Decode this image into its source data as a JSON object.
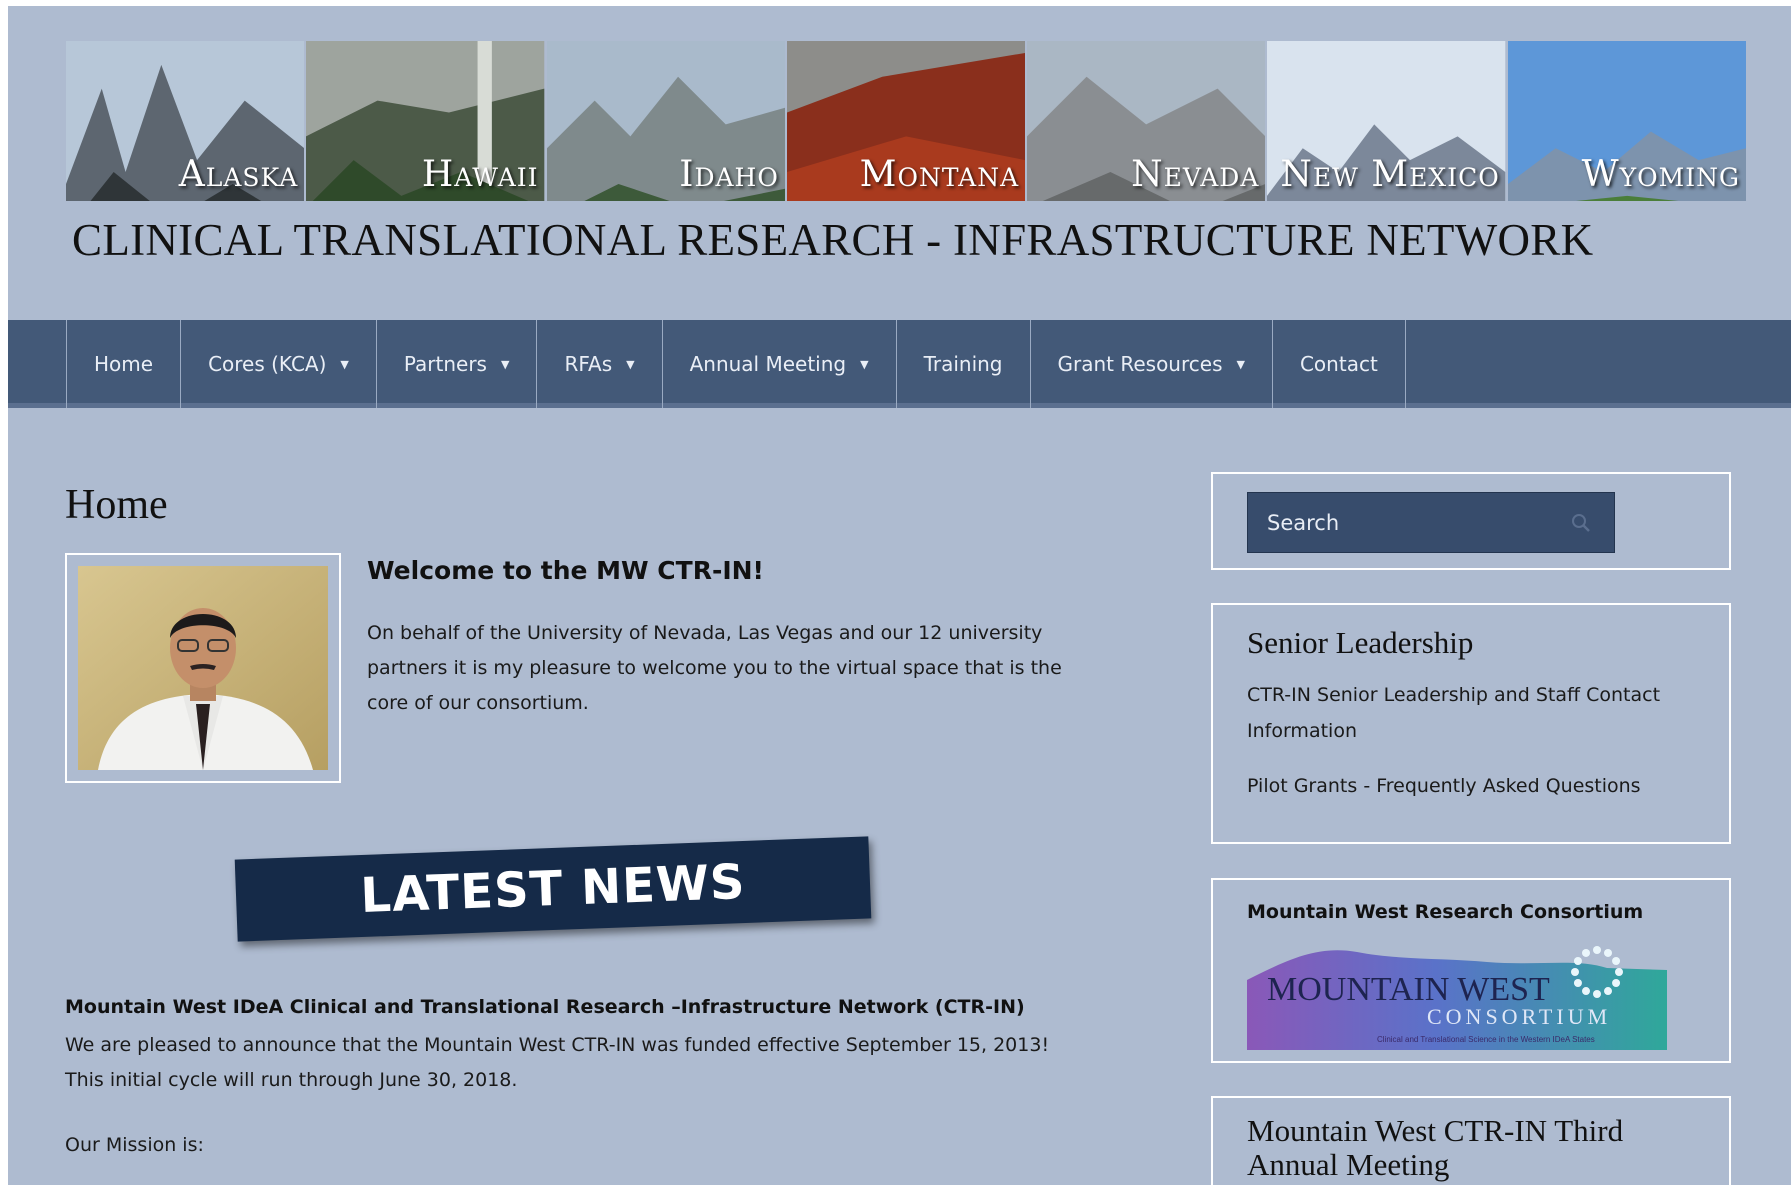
{
  "banner": {
    "states": [
      {
        "name": "Alaska",
        "sky": "#b7c7d8",
        "far": "#5d6670",
        "near": "#2f3538"
      },
      {
        "name": "Hawaii",
        "sky": "#9ea49e",
        "far": "#4c5a48",
        "near": "#2f4a2a"
      },
      {
        "name": "Idaho",
        "sky": "#a9bacb",
        "far": "#7f8a8c",
        "near": "#3d5a3a"
      },
      {
        "name": "Montana",
        "sky": "#8d8d8a",
        "far": "#8a2f1c",
        "near": "#a93a1e"
      },
      {
        "name": "Nevada",
        "sky": "#aab7c4",
        "far": "#8a8e92",
        "near": "#676a6b"
      },
      {
        "name": "New Mexico",
        "sky": "#d9e3ee",
        "far": "#7c889a",
        "near": "#6f7478"
      },
      {
        "name": "Wyoming",
        "sky": "#5d97d8",
        "far": "#7d93ad",
        "near": "#4a7e3a"
      }
    ]
  },
  "site": {
    "title": "CLINICAL TRANSLATIONAL RESEARCH - INFRASTRUCTURE NETWORK"
  },
  "nav": {
    "items": [
      {
        "label": "Home",
        "dropdown": false
      },
      {
        "label": "Cores (KCA)",
        "dropdown": true
      },
      {
        "label": "Partners",
        "dropdown": true
      },
      {
        "label": "RFAs",
        "dropdown": true
      },
      {
        "label": "Annual Meeting",
        "dropdown": true
      },
      {
        "label": "Training",
        "dropdown": false
      },
      {
        "label": "Grant Resources",
        "dropdown": true
      },
      {
        "label": "Contact",
        "dropdown": false
      }
    ]
  },
  "main": {
    "page_title": "Home",
    "welcome_title": "Welcome to the MW CTR-IN!",
    "welcome_text": "On behalf of the University of Nevada, Las Vegas and our 12 university partners it is my pleasure to welcome you to the virtual space that is the core of our consortium.",
    "news_label": "LATEST NEWS",
    "news_heading": "Mountain West IDeA Clinical and Translational Research –Infrastructure Network (CTR-IN)",
    "news_body": "We are pleased to announce that the Mountain West CTR-IN was funded effective September 15, 2013! This initial cycle will run through June 30, 2018.",
    "mission": "Our Mission is:"
  },
  "sidebar": {
    "search_placeholder": "Search",
    "leadership": {
      "title": "Senior Leadership",
      "links": [
        "CTR-IN Senior Leadership and Staff Contact Information",
        "Pilot Grants - Frequently Asked Questions"
      ]
    },
    "consortium": {
      "title": "Mountain West Research Consortium",
      "logo_line1": "MOUNTAIN WEST",
      "logo_line2": "CONSORTIUM",
      "logo_tagline": "Clinical and Translational Science in the Western IDeA States"
    },
    "annual": {
      "title": "Mountain West CTR-IN Third Annual Meeting"
    }
  },
  "colors": {
    "page_bg": "#aebbd0",
    "nav_bg": "#435978",
    "search_bg": "#374c6c",
    "news_bg": "#152a48"
  }
}
